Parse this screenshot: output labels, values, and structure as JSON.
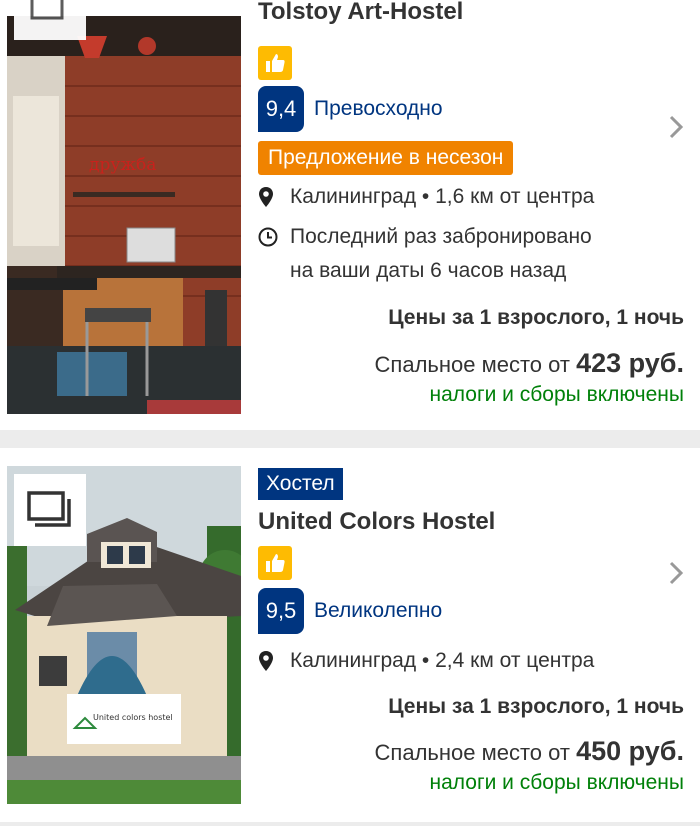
{
  "listings": [
    {
      "name": "Tolstoy Art-Hostel",
      "type_badge": "",
      "score": "9,4",
      "score_label": "Превосходно",
      "promo": "Предложение в несезон",
      "location": "Калининград • 1,6 км от центра",
      "booking_note_line1": "Последний раз забронировано",
      "booking_note_line2": "на ваши даты 6 часов назад",
      "price_header": "Цены за 1 взрослого, 1 ночь",
      "price_prefix": "Спальное место от",
      "price": "423 руб.",
      "tax_note": "налоги и сборы включены",
      "photo_sign": "дружба"
    },
    {
      "name": "United Colors Hostel",
      "type_badge": "Хостел",
      "score": "9,5",
      "score_label": "Великолепно",
      "location": "Калининград • 2,4 км от центра",
      "price_header": "Цены за 1 взрослого, 1 ночь",
      "price_prefix": "Спальное место от",
      "price": "450 руб.",
      "tax_note": "налоги и сборы включены",
      "photo_sign": "United colors hostel"
    }
  ],
  "colors": {
    "brand_blue": "#003580",
    "promo_orange": "#f08300",
    "thumb_yellow": "#febb02",
    "tax_green": "#008009"
  },
  "icons": [
    "thumbs-up-icon",
    "location-pin-icon",
    "clock-icon",
    "chevron-right-icon",
    "gallery-icon"
  ]
}
